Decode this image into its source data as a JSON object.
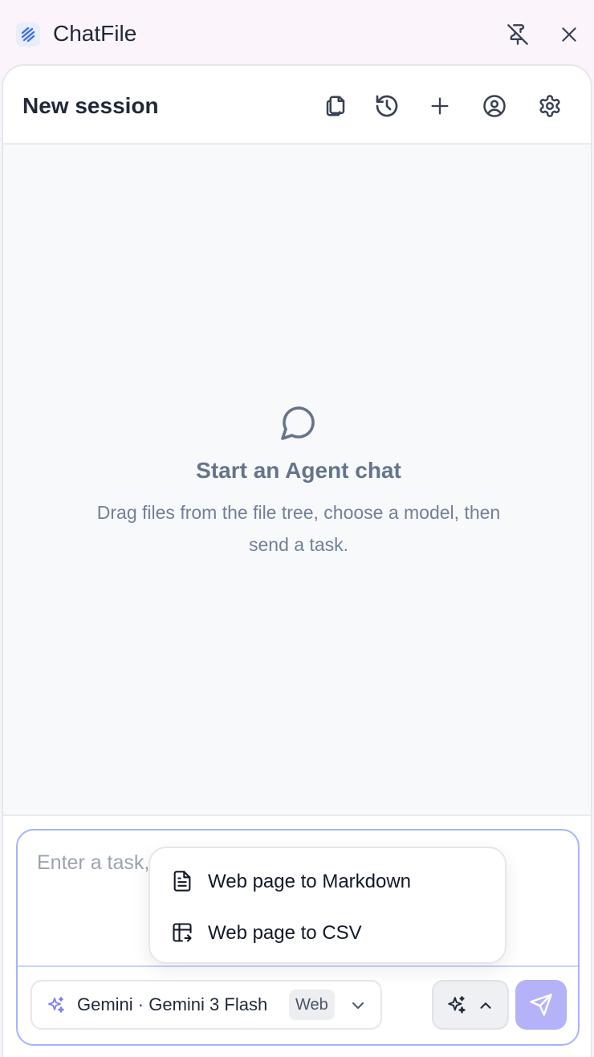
{
  "app": {
    "title": "ChatFile",
    "pin_icon": "pin-off-icon",
    "close_icon": "close-icon",
    "brand_color": "#3b6fe8"
  },
  "header": {
    "session_title": "New session",
    "actions": [
      "copy-icon",
      "history-icon",
      "plus-icon",
      "user-circle-icon",
      "settings-icon"
    ]
  },
  "empty_state": {
    "icon": "chat-bubble-icon",
    "title": "Start an Agent chat",
    "description": "Drag files from the file tree, choose a model, then send a task."
  },
  "composer": {
    "placeholder": "Enter a task, Enter to send, Shift+Enter for new line",
    "model_label": "Gemini · Gemini 3 Flash",
    "model_badge": "Web",
    "accent_color": "#a5b4fc",
    "send_color": "#b4b2f8"
  },
  "menu": {
    "items": [
      {
        "label": "Web page to Markdown",
        "icon": "document-icon"
      },
      {
        "label": "Web page to CSV",
        "icon": "table-export-icon"
      }
    ]
  }
}
